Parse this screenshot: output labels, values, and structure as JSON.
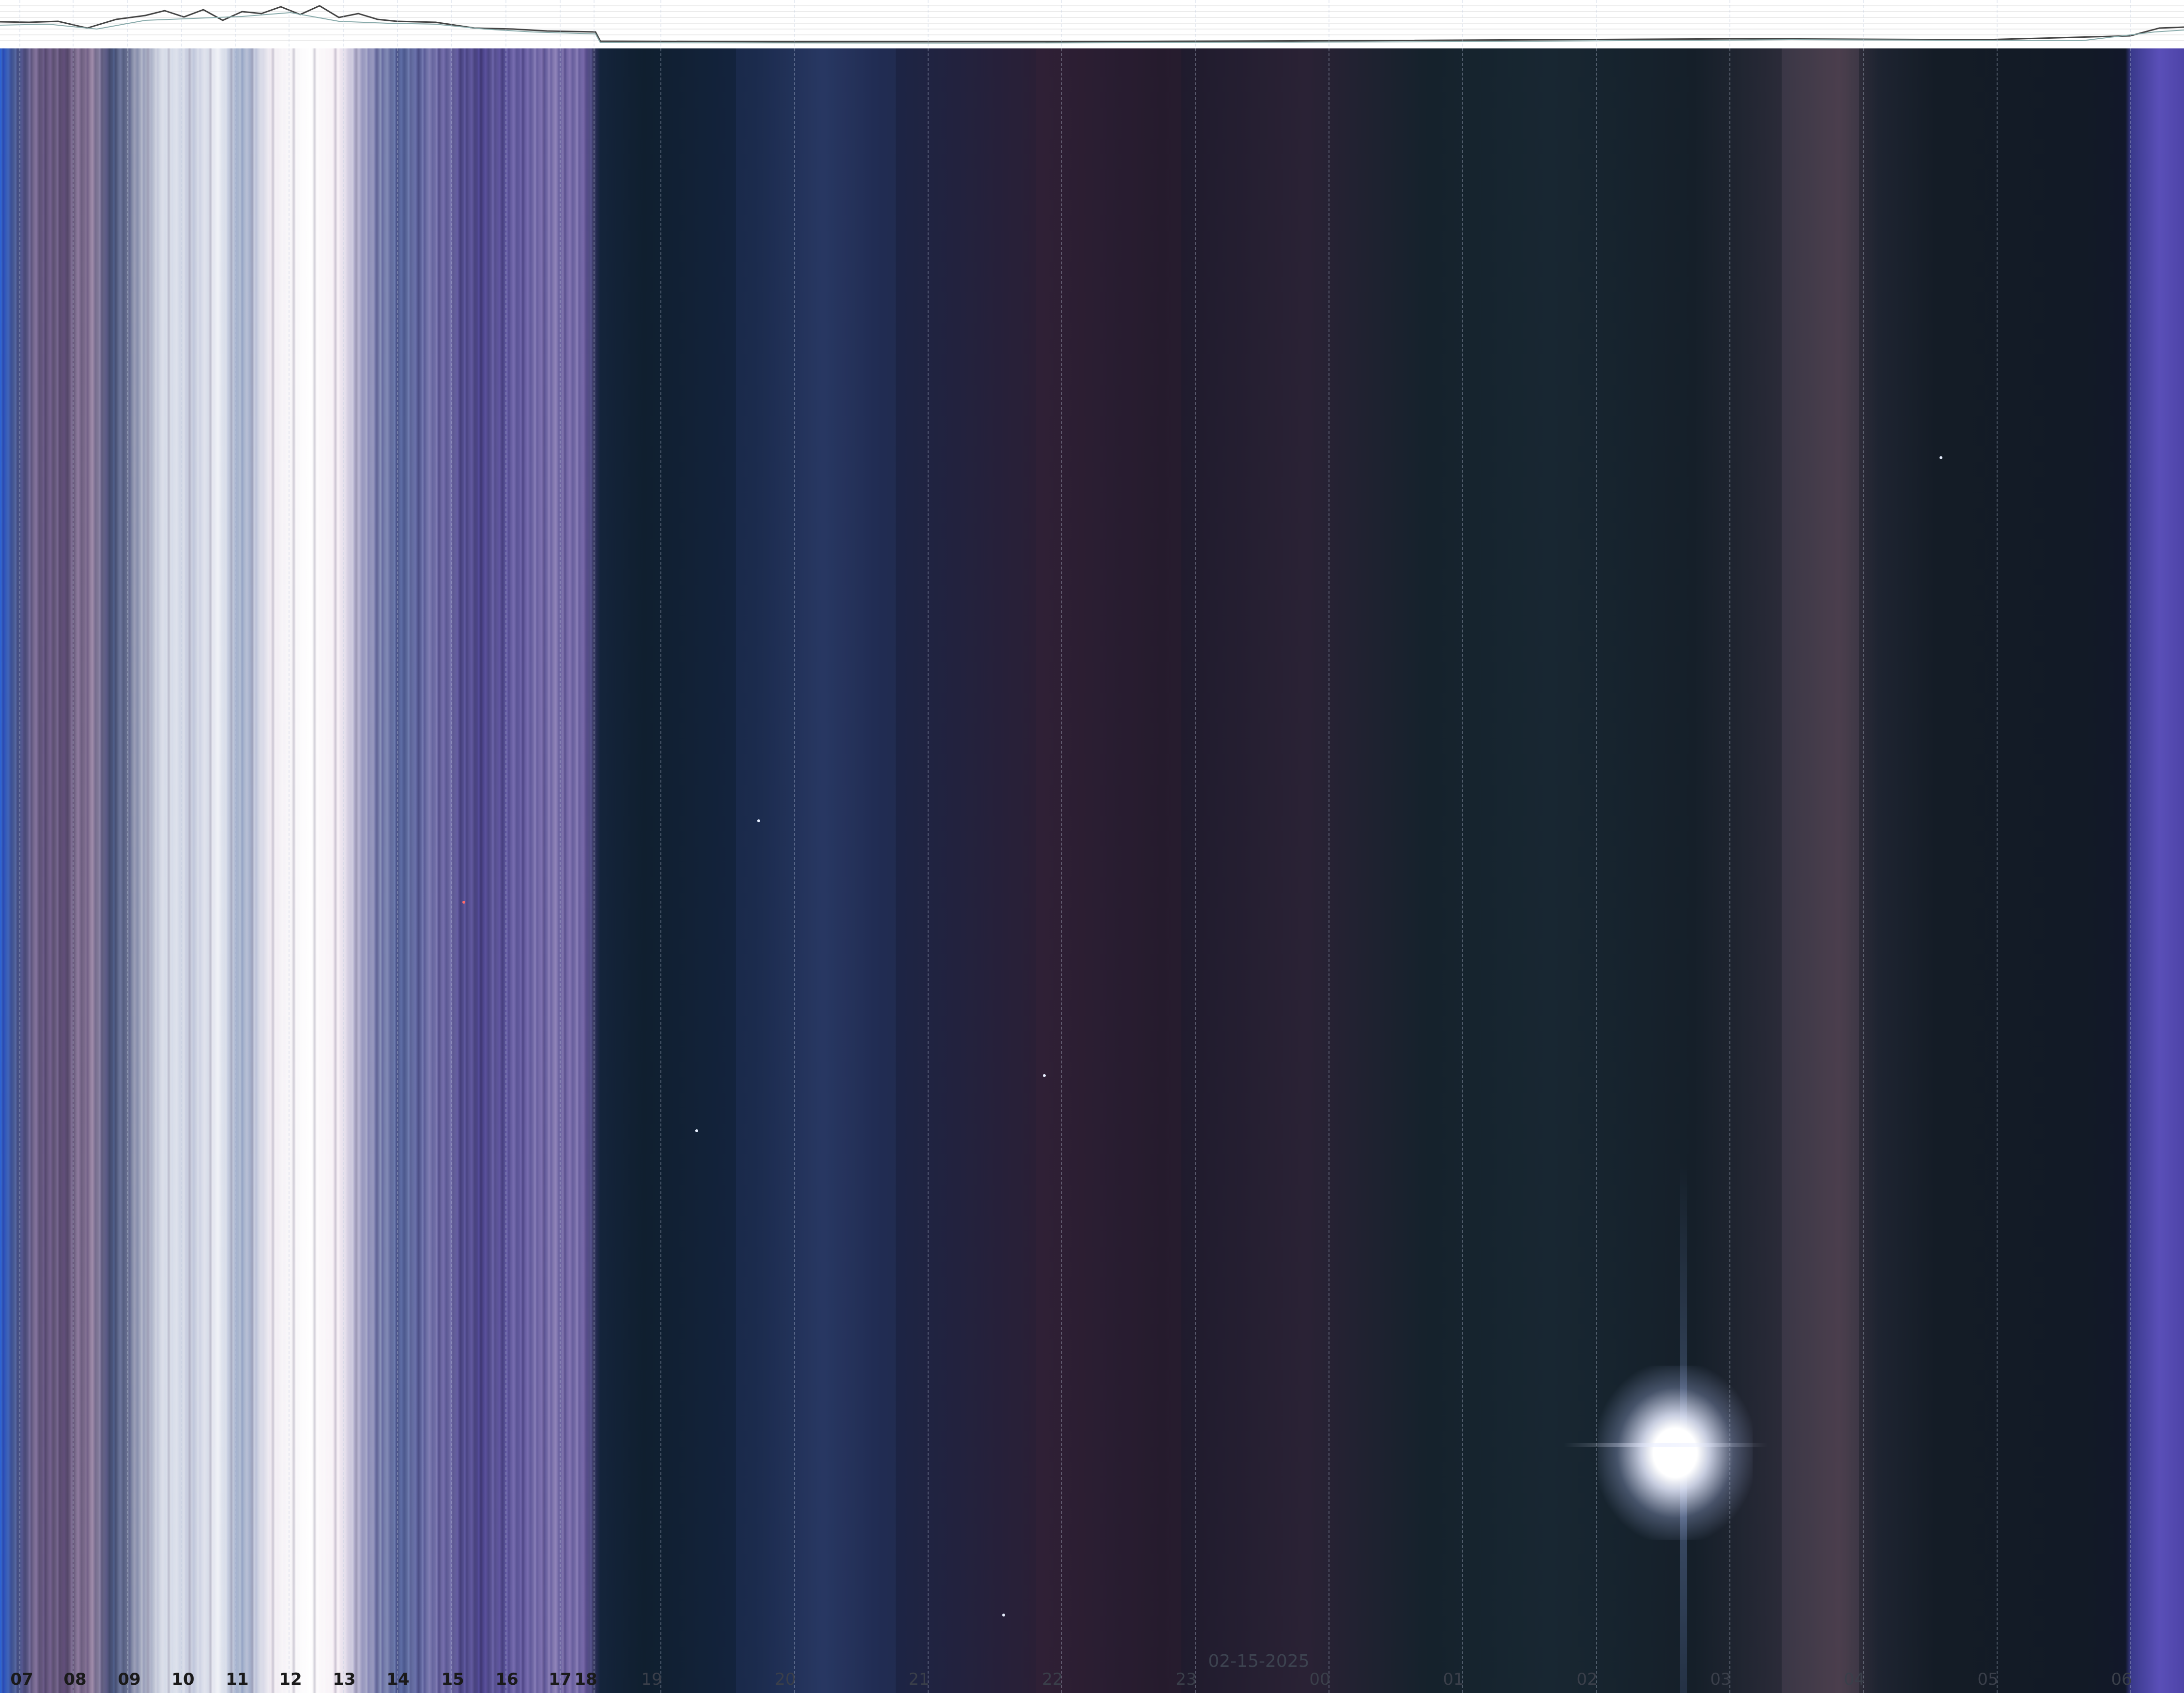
{
  "date_label": "02-15-2025",
  "hour_labels": [
    "07",
    "08",
    "09",
    "10",
    "11",
    "12",
    "13",
    "14",
    "15",
    "16",
    "17",
    "18",
    "19",
    "20",
    "21",
    "22",
    "23",
    "00",
    "01",
    "02",
    "03",
    "04",
    "05",
    "06"
  ],
  "colors": {
    "day_sky": "#b8b4d0",
    "night_sky": "#101f2f",
    "moon": "#ffffff",
    "graph_bg": "#ffffff"
  }
}
